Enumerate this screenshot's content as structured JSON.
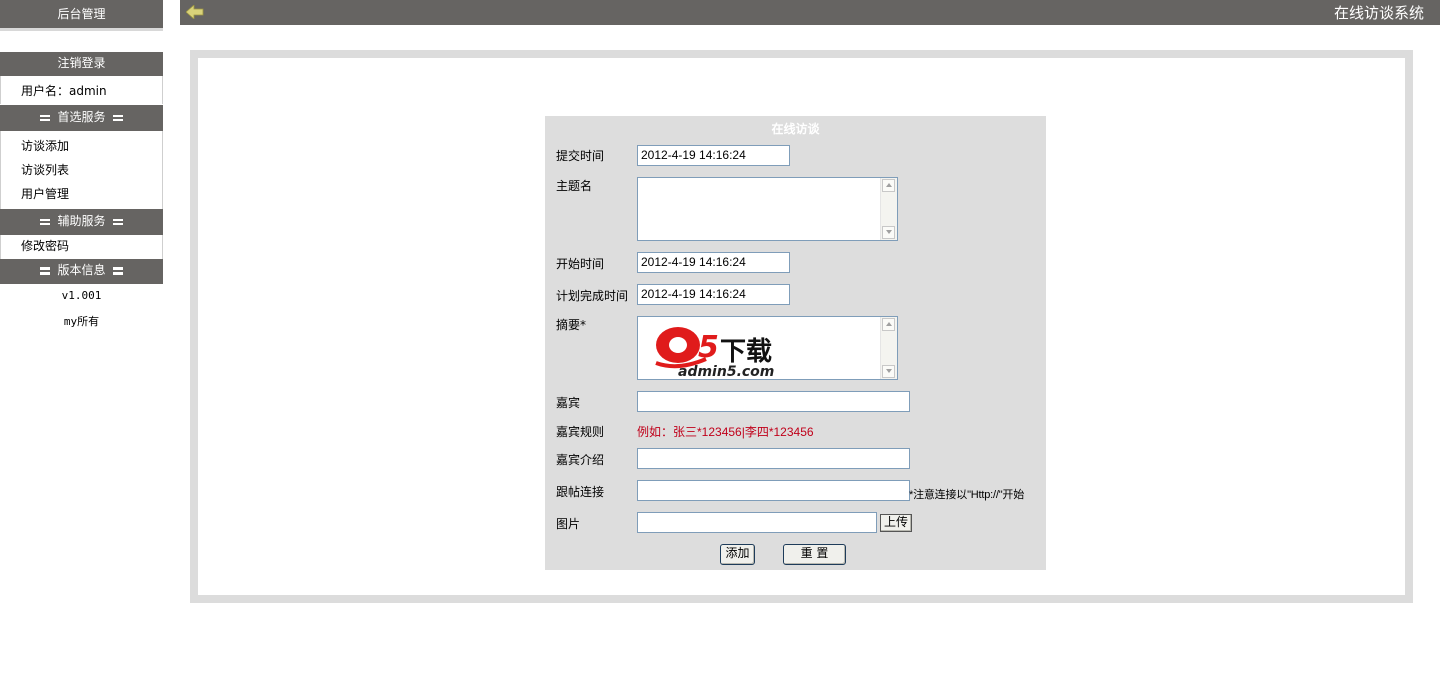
{
  "sidebar": {
    "title": "后台管理",
    "logout": "注销登录",
    "username_label": "用户名：admin",
    "section_preferred": "首选服务",
    "preferred_items": [
      "访谈添加",
      "访谈列表",
      "用户管理"
    ],
    "section_aux": "辅助服务",
    "aux_items": [
      "修改密码"
    ],
    "section_version": "版本信息",
    "version": "v1.001",
    "owner": "my所有"
  },
  "header": {
    "title": "在线访谈系统",
    "back_icon": "back-arrow-icon"
  },
  "form": {
    "title": "在线访谈",
    "submit_time_label": "提交时间",
    "submit_time_value": "2012-4-19 14:16:24",
    "subject_label": "主题名",
    "start_time_label": "开始时间",
    "start_time_value": "2012-4-19 14:16:24",
    "plan_end_label": "计划完成时间",
    "plan_end_value": "2012-4-19 14:16:24",
    "summary_label": "摘要*",
    "watermark": {
      "brand": "下载",
      "site": "admin5.com"
    },
    "guest_label": "嘉宾",
    "guest_rule_label": "嘉宾规则",
    "guest_rule_example": "例如：张三*123456|李四*123456",
    "guest_intro_label": "嘉宾介绍",
    "link_label": "跟帖连接",
    "link_hint": "*注意连接以\"Http://\"开始",
    "image_label": "图片",
    "upload_button": "上传",
    "add_button": "添加",
    "reset_button": "重 置"
  },
  "colors": {
    "bar": "#666462",
    "panel": "#dddddd",
    "example_red": "#c0001a"
  }
}
